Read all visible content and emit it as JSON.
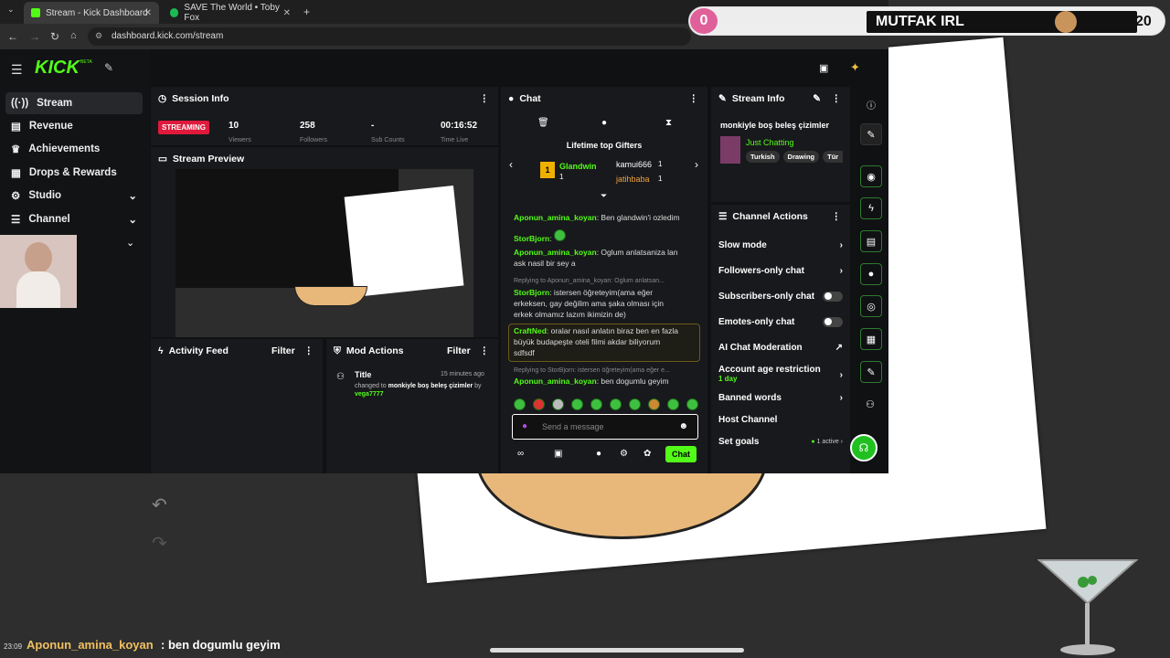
{
  "browser": {
    "tabs": [
      {
        "title": "Stream - Kick Dashboard",
        "active": true
      },
      {
        "title": "SAVE The World • Toby Fox",
        "active": false
      }
    ],
    "url": "dashboard.kick.com/stream"
  },
  "overlay": {
    "left_counter": "0",
    "title": "MUTFAK IRL",
    "right_counter": "20",
    "bottom_time": "23:09",
    "bottom_user": "Aponun_amina_koyan",
    "bottom_text": ": ben dogumlu geyim"
  },
  "app": {
    "logo": "KICK",
    "logo_badge": "BETA",
    "sidebar": [
      {
        "label": "Stream",
        "icon": "stream-icon"
      },
      {
        "label": "Revenue",
        "icon": "revenue-icon"
      },
      {
        "label": "Achievements",
        "icon": "trophy-icon"
      },
      {
        "label": "Drops & Rewards",
        "icon": "gift-icon"
      },
      {
        "label": "Studio",
        "icon": "studio-icon"
      },
      {
        "label": "Channel",
        "icon": "channel-icon"
      }
    ]
  },
  "session": {
    "title": "Session Info",
    "status": "STREAMING",
    "stats": [
      {
        "value": "10",
        "label": "Viewers"
      },
      {
        "value": "258",
        "label": "Followers"
      },
      {
        "value": "-",
        "label": "Sub Counts"
      },
      {
        "value": "00:16:52",
        "label": "Time Live"
      }
    ]
  },
  "preview": {
    "title": "Stream Preview"
  },
  "activity": {
    "title": "Activity Feed",
    "filter": "Filter"
  },
  "mod": {
    "title": "Mod Actions",
    "filter": "Filter",
    "entry": {
      "heading": "Title",
      "time": "15 minutes ago",
      "text1": "changed to ",
      "bold": "monkiyle boş beleş çizimler",
      "by": " by ",
      "user": "vega7777"
    }
  },
  "chat": {
    "title": "Chat",
    "gifters_title": "Lifetime top Gifters",
    "gifters": [
      {
        "rank": "1",
        "name": "Glandwin",
        "count": "1"
      },
      {
        "name": "kamui666",
        "count": "1"
      },
      {
        "name": "jatihbaba",
        "count": "1"
      }
    ],
    "messages": [
      {
        "user": "Aponun_amina_koyan",
        "text": ": Ben glandwin'i ozledim"
      },
      {
        "user": "StorBjorn",
        "text": ":"
      },
      {
        "user": "Aponun_amina_koyan",
        "text": ": Oglum anlatsaniza lan ask nasil bir sey a"
      },
      {
        "reply": "Replying to Aponun_amina_koyan: Oglum anlatsan...",
        "user": "StorBjorn",
        "text": ": istersen öğreteyim(ama eğer erkeksen, gay değilim ama şaka olması için erkek olmamız lazım ikimizin de)"
      },
      {
        "user": "CraftNed",
        "text": ": oralar nasıl anlatın biraz ben en fazla büyük budapeşte oteli filmi akdar biliyorum sdfsdf"
      },
      {
        "reply": "Replying to StorBjorn: istersen öğreteyim(ama eğer e...",
        "user": "Aponun_amina_koyan",
        "text": ": ben dogumlu geyim"
      }
    ],
    "placeholder": "Send a message",
    "send": "Chat"
  },
  "stream_info": {
    "title": "Stream Info",
    "stream_title": "monkiyle boş beleş çizimler",
    "category": "Just Chatting",
    "tags": [
      "Turkish",
      "Drawing",
      "Tür"
    ]
  },
  "channel_actions": {
    "title": "Channel Actions",
    "rows": [
      {
        "label": "Slow mode",
        "kind": "arrow"
      },
      {
        "label": "Followers-only chat",
        "kind": "arrow"
      },
      {
        "label": "Subscribers-only chat",
        "kind": "toggle"
      },
      {
        "label": "Emotes-only chat",
        "kind": "toggle"
      },
      {
        "label": "AI Chat Moderation",
        "kind": "ext"
      },
      {
        "label": "Account age restriction",
        "sub": "1 day",
        "kind": "arrow"
      },
      {
        "label": "Banned words",
        "kind": "arrow"
      },
      {
        "label": "Host Channel",
        "kind": "none"
      },
      {
        "label": "Set goals",
        "badge": "1 active",
        "kind": "arrow"
      }
    ]
  },
  "colors": {
    "accent": "#53fc18",
    "streaming": "#e01a3c",
    "overlay_pink": "#e0609a"
  }
}
